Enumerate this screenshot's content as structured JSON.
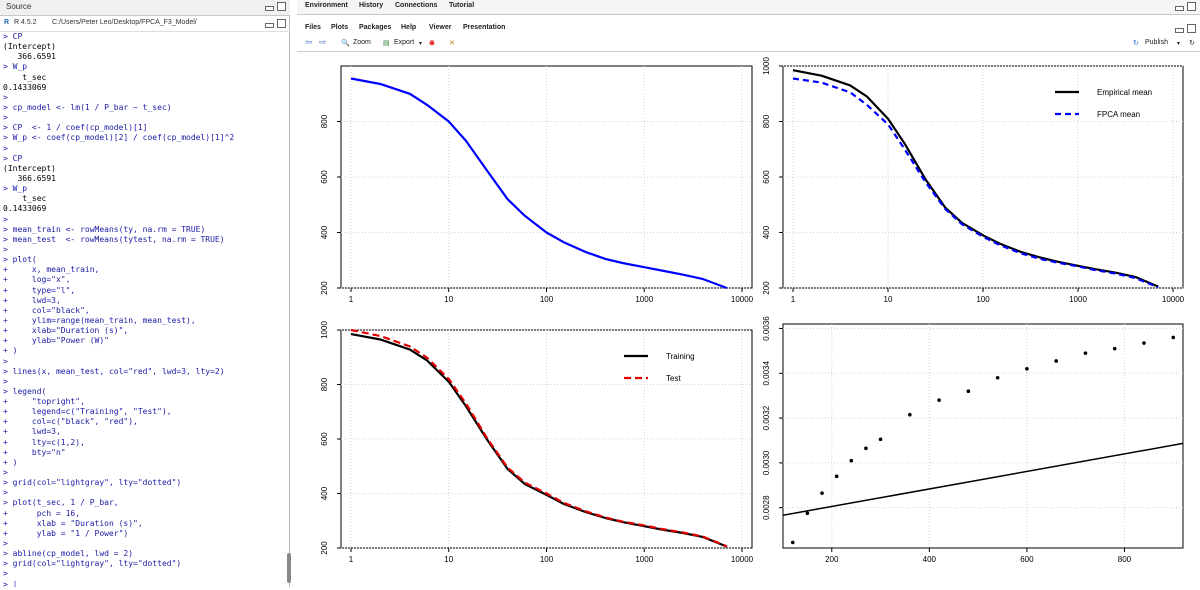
{
  "source_pane": {
    "title": "Source"
  },
  "console": {
    "r_version": "R 4.5.2",
    "path": "C:/Users/Peter Leo/Desktop/FPCA_F3_Model/",
    "lines": [
      {
        "t": "> CP",
        "k": "c"
      },
      {
        "t": "(Intercept)",
        "k": "o"
      },
      {
        "t": "   366.6591",
        "k": "o"
      },
      {
        "t": "> W_p",
        "k": "c"
      },
      {
        "t": "    t_sec",
        "k": "o"
      },
      {
        "t": "0.1433069",
        "k": "o"
      },
      {
        "t": ">",
        "k": "c"
      },
      {
        "t": "> cp_model <- lm(1 / P_bar ~ t_sec)",
        "k": "c"
      },
      {
        "t": ">",
        "k": "c"
      },
      {
        "t": "> CP  <- 1 / coef(cp_model)[1]",
        "k": "c"
      },
      {
        "t": "> W_p <- coef(cp_model)[2] / coef(cp_model)[1]^2",
        "k": "c"
      },
      {
        "t": ">",
        "k": "c"
      },
      {
        "t": "> CP",
        "k": "c"
      },
      {
        "t": "(Intercept)",
        "k": "o"
      },
      {
        "t": "   366.6591",
        "k": "o"
      },
      {
        "t": "> W_p",
        "k": "c"
      },
      {
        "t": "    t_sec",
        "k": "o"
      },
      {
        "t": "0.1433069",
        "k": "o"
      },
      {
        "t": ">",
        "k": "c"
      },
      {
        "t": "> mean_train <- rowMeans(ty, na.rm = TRUE)",
        "k": "c"
      },
      {
        "t": "> mean_test  <- rowMeans(tytest, na.rm = TRUE)",
        "k": "c"
      },
      {
        "t": ">",
        "k": "c"
      },
      {
        "t": "> plot(",
        "k": "c"
      },
      {
        "t": "+     x, mean_train,",
        "k": "c"
      },
      {
        "t": "+     log=\"x\",",
        "k": "c"
      },
      {
        "t": "+     type=\"l\",",
        "k": "c"
      },
      {
        "t": "+     lwd=3,",
        "k": "c"
      },
      {
        "t": "+     col=\"black\",",
        "k": "c"
      },
      {
        "t": "+     ylim=range(mean_train, mean_test),",
        "k": "c"
      },
      {
        "t": "+     xlab=\"Duration (s)\",",
        "k": "c"
      },
      {
        "t": "+     ylab=\"Power (W)\"",
        "k": "c"
      },
      {
        "t": "+ )",
        "k": "c"
      },
      {
        "t": ">",
        "k": "c"
      },
      {
        "t": "> lines(x, mean_test, col=\"red\", lwd=3, lty=2)",
        "k": "c"
      },
      {
        "t": ">",
        "k": "c"
      },
      {
        "t": "> legend(",
        "k": "c"
      },
      {
        "t": "+     \"topright\",",
        "k": "c"
      },
      {
        "t": "+     legend=c(\"Training\", \"Test\"),",
        "k": "c"
      },
      {
        "t": "+     col=c(\"black\", \"red\"),",
        "k": "c"
      },
      {
        "t": "+     lwd=3,",
        "k": "c"
      },
      {
        "t": "+     lty=c(1,2),",
        "k": "c"
      },
      {
        "t": "+     bty=\"n\"",
        "k": "c"
      },
      {
        "t": "+ )",
        "k": "c"
      },
      {
        "t": ">",
        "k": "c"
      },
      {
        "t": "> grid(col=\"lightgray\", lty=\"dotted\")",
        "k": "c"
      },
      {
        "t": ">",
        "k": "c"
      },
      {
        "t": "> plot(t_sec, 1 / P_bar,",
        "k": "c"
      },
      {
        "t": "+      pch = 16,",
        "k": "c"
      },
      {
        "t": "+      xlab = \"Duration (s)\",",
        "k": "c"
      },
      {
        "t": "+      ylab = \"1 / Power\")",
        "k": "c"
      },
      {
        "t": ">",
        "k": "c"
      },
      {
        "t": "> abline(cp_model, lwd = 2)",
        "k": "c"
      },
      {
        "t": "> grid(col=\"lightgray\", lty=\"dotted\")",
        "k": "c"
      },
      {
        "t": ">",
        "k": "c"
      },
      {
        "t": "> |",
        "k": "c"
      }
    ]
  },
  "env_tabs": [
    "Environment",
    "History",
    "Connections",
    "Tutorial"
  ],
  "files_tabs": [
    "Files",
    "Plots",
    "Packages",
    "Help",
    "Viewer",
    "Presentation"
  ],
  "toolbar": {
    "zoom": "Zoom",
    "export": "Export",
    "publish": "Publish"
  },
  "colors": {
    "blue": "#1a1aa6",
    "black": "#000000",
    "red": "#e00000"
  },
  "chart_data": [
    {
      "type": "line",
      "log_x": true,
      "xlim": [
        1,
        10000
      ],
      "ylim": [
        200,
        1000
      ],
      "x_ticks": [
        "1",
        "10",
        "100",
        "1000",
        "10000"
      ],
      "y_ticks": [
        "200",
        "400",
        "600",
        "800"
      ],
      "series": [
        {
          "color": "#0000ff",
          "dash": "none",
          "x": [
            1,
            2,
            4,
            6,
            10,
            15,
            25,
            40,
            60,
            100,
            150,
            250,
            400,
            600,
            1000,
            1500,
            2500,
            4000,
            7000
          ],
          "y": [
            955,
            935,
            900,
            860,
            800,
            730,
            620,
            520,
            460,
            400,
            365,
            330,
            305,
            290,
            275,
            263,
            248,
            232,
            200
          ]
        }
      ],
      "grid": true
    },
    {
      "type": "line",
      "log_x": true,
      "xlim": [
        1,
        10000
      ],
      "ylim": [
        200,
        1000
      ],
      "x_ticks": [
        "1",
        "10",
        "100",
        "1000",
        "10000"
      ],
      "y_ticks": [
        "200",
        "400",
        "600",
        "800",
        "1000"
      ],
      "series": [
        {
          "name": "Empirical mean",
          "color": "#000000",
          "dash": "none",
          "x": [
            1,
            2,
            4,
            6,
            10,
            15,
            25,
            40,
            60,
            100,
            150,
            250,
            400,
            600,
            1000,
            1500,
            2500,
            4000,
            7000
          ],
          "y": [
            985,
            965,
            930,
            890,
            810,
            720,
            590,
            490,
            435,
            390,
            360,
            330,
            310,
            295,
            280,
            268,
            255,
            240,
            205
          ]
        },
        {
          "name": "FPCA mean",
          "color": "#0000ff",
          "dash": "6,4",
          "x": [
            1,
            2,
            4,
            6,
            10,
            15,
            25,
            40,
            60,
            100,
            150,
            250,
            400,
            600,
            1000,
            1500,
            2500,
            4000,
            7000
          ],
          "y": [
            955,
            940,
            905,
            860,
            790,
            700,
            580,
            485,
            430,
            385,
            355,
            325,
            305,
            292,
            278,
            265,
            252,
            236,
            202
          ]
        }
      ],
      "legend": "top-right",
      "grid": true
    },
    {
      "type": "line",
      "log_x": true,
      "xlim": [
        1,
        10000
      ],
      "ylim": [
        200,
        1000
      ],
      "x_ticks": [
        "1",
        "10",
        "100",
        "1000",
        "10000"
      ],
      "y_ticks": [
        "200",
        "400",
        "600",
        "800",
        "1000"
      ],
      "series": [
        {
          "name": "Training",
          "color": "#000000",
          "dash": "none",
          "x": [
            1,
            2,
            4,
            6,
            10,
            15,
            25,
            40,
            60,
            100,
            150,
            250,
            400,
            600,
            1000,
            1500,
            2500,
            4000,
            7000
          ],
          "y": [
            985,
            965,
            928,
            888,
            810,
            720,
            595,
            490,
            435,
            395,
            362,
            332,
            310,
            295,
            280,
            268,
            255,
            240,
            205
          ]
        },
        {
          "name": "Test",
          "color": "#e00000",
          "dash": "7,4",
          "x": [
            1,
            2,
            4,
            6,
            10,
            15,
            25,
            40,
            60,
            100,
            150,
            250,
            400,
            600,
            1000,
            1500,
            2500,
            4000,
            7000
          ],
          "y": [
            1000,
            978,
            940,
            898,
            820,
            730,
            600,
            495,
            440,
            400,
            366,
            335,
            312,
            297,
            283,
            270,
            257,
            242,
            206
          ]
        }
      ],
      "legend": "top-right",
      "grid": true
    },
    {
      "type": "scatter",
      "log_x": false,
      "xlim": [
        100,
        920
      ],
      "ylim": [
        0.00262,
        0.00362
      ],
      "x_ticks": [
        "200",
        "400",
        "600",
        "800"
      ],
      "y_ticks": [
        "0.0028",
        "0.0030",
        "0.0032",
        "0.0034",
        "0.0036"
      ],
      "points": {
        "x": [
          120,
          150,
          180,
          210,
          240,
          270,
          300,
          360,
          420,
          480,
          540,
          600,
          660,
          720,
          780,
          840,
          900
        ],
        "y": [
          0.002645,
          0.002775,
          0.002865,
          0.00294,
          0.00301,
          0.003065,
          0.003105,
          0.003215,
          0.00328,
          0.00332,
          0.00338,
          0.00342,
          0.003455,
          0.00349,
          0.00351,
          0.003535,
          0.00356
        ]
      },
      "line": {
        "intercept": 0.0027273,
        "slope": 3.9085e-07
      },
      "grid": true
    }
  ]
}
